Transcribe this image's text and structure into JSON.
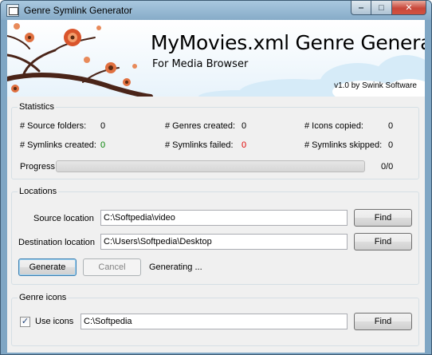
{
  "window": {
    "title": "Genre Symlink Generator",
    "caption_minimize": "‒",
    "caption_maximize": "□",
    "caption_close": "✕"
  },
  "banner": {
    "title": "MyMovies.xml Genre Generator",
    "subtitle": "For Media Browser",
    "version": "v1.0 by Swink Software"
  },
  "statistics": {
    "label": "Statistics",
    "source_folders_label": "# Source folders:",
    "source_folders_value": "0",
    "genres_created_label": "# Genres created:",
    "genres_created_value": "0",
    "icons_copied_label": "# Icons copied:",
    "icons_copied_value": "0",
    "symlinks_created_label": "# Symlinks created:",
    "symlinks_created_value": "0",
    "symlinks_failed_label": "# Symlinks failed:",
    "symlinks_failed_value": "0",
    "symlinks_skipped_label": "# Symlinks skipped:",
    "symlinks_skipped_value": "0",
    "progress_label": "Progress",
    "progress_text": "0/0",
    "progress_fraction": 0
  },
  "locations": {
    "label": "Locations",
    "source_label": "Source location",
    "source_value": "C:\\Softpedia\\video",
    "source_find": "Find",
    "dest_label": "Destination location",
    "dest_value": "C:\\Users\\Softpedia\\Desktop",
    "dest_find": "Find",
    "generate_button": "Generate",
    "cancel_button": "Cancel",
    "status_text": "Generating ..."
  },
  "genre_icons": {
    "label": "Genre icons",
    "use_icons_label": "Use icons",
    "use_icons_checked": true,
    "check_glyph": "✓",
    "icons_path": "C:\\Softpedia",
    "find_button": "Find"
  },
  "colors": {
    "green": "#008000",
    "red": "#e00000",
    "flower": "#d9542b"
  }
}
